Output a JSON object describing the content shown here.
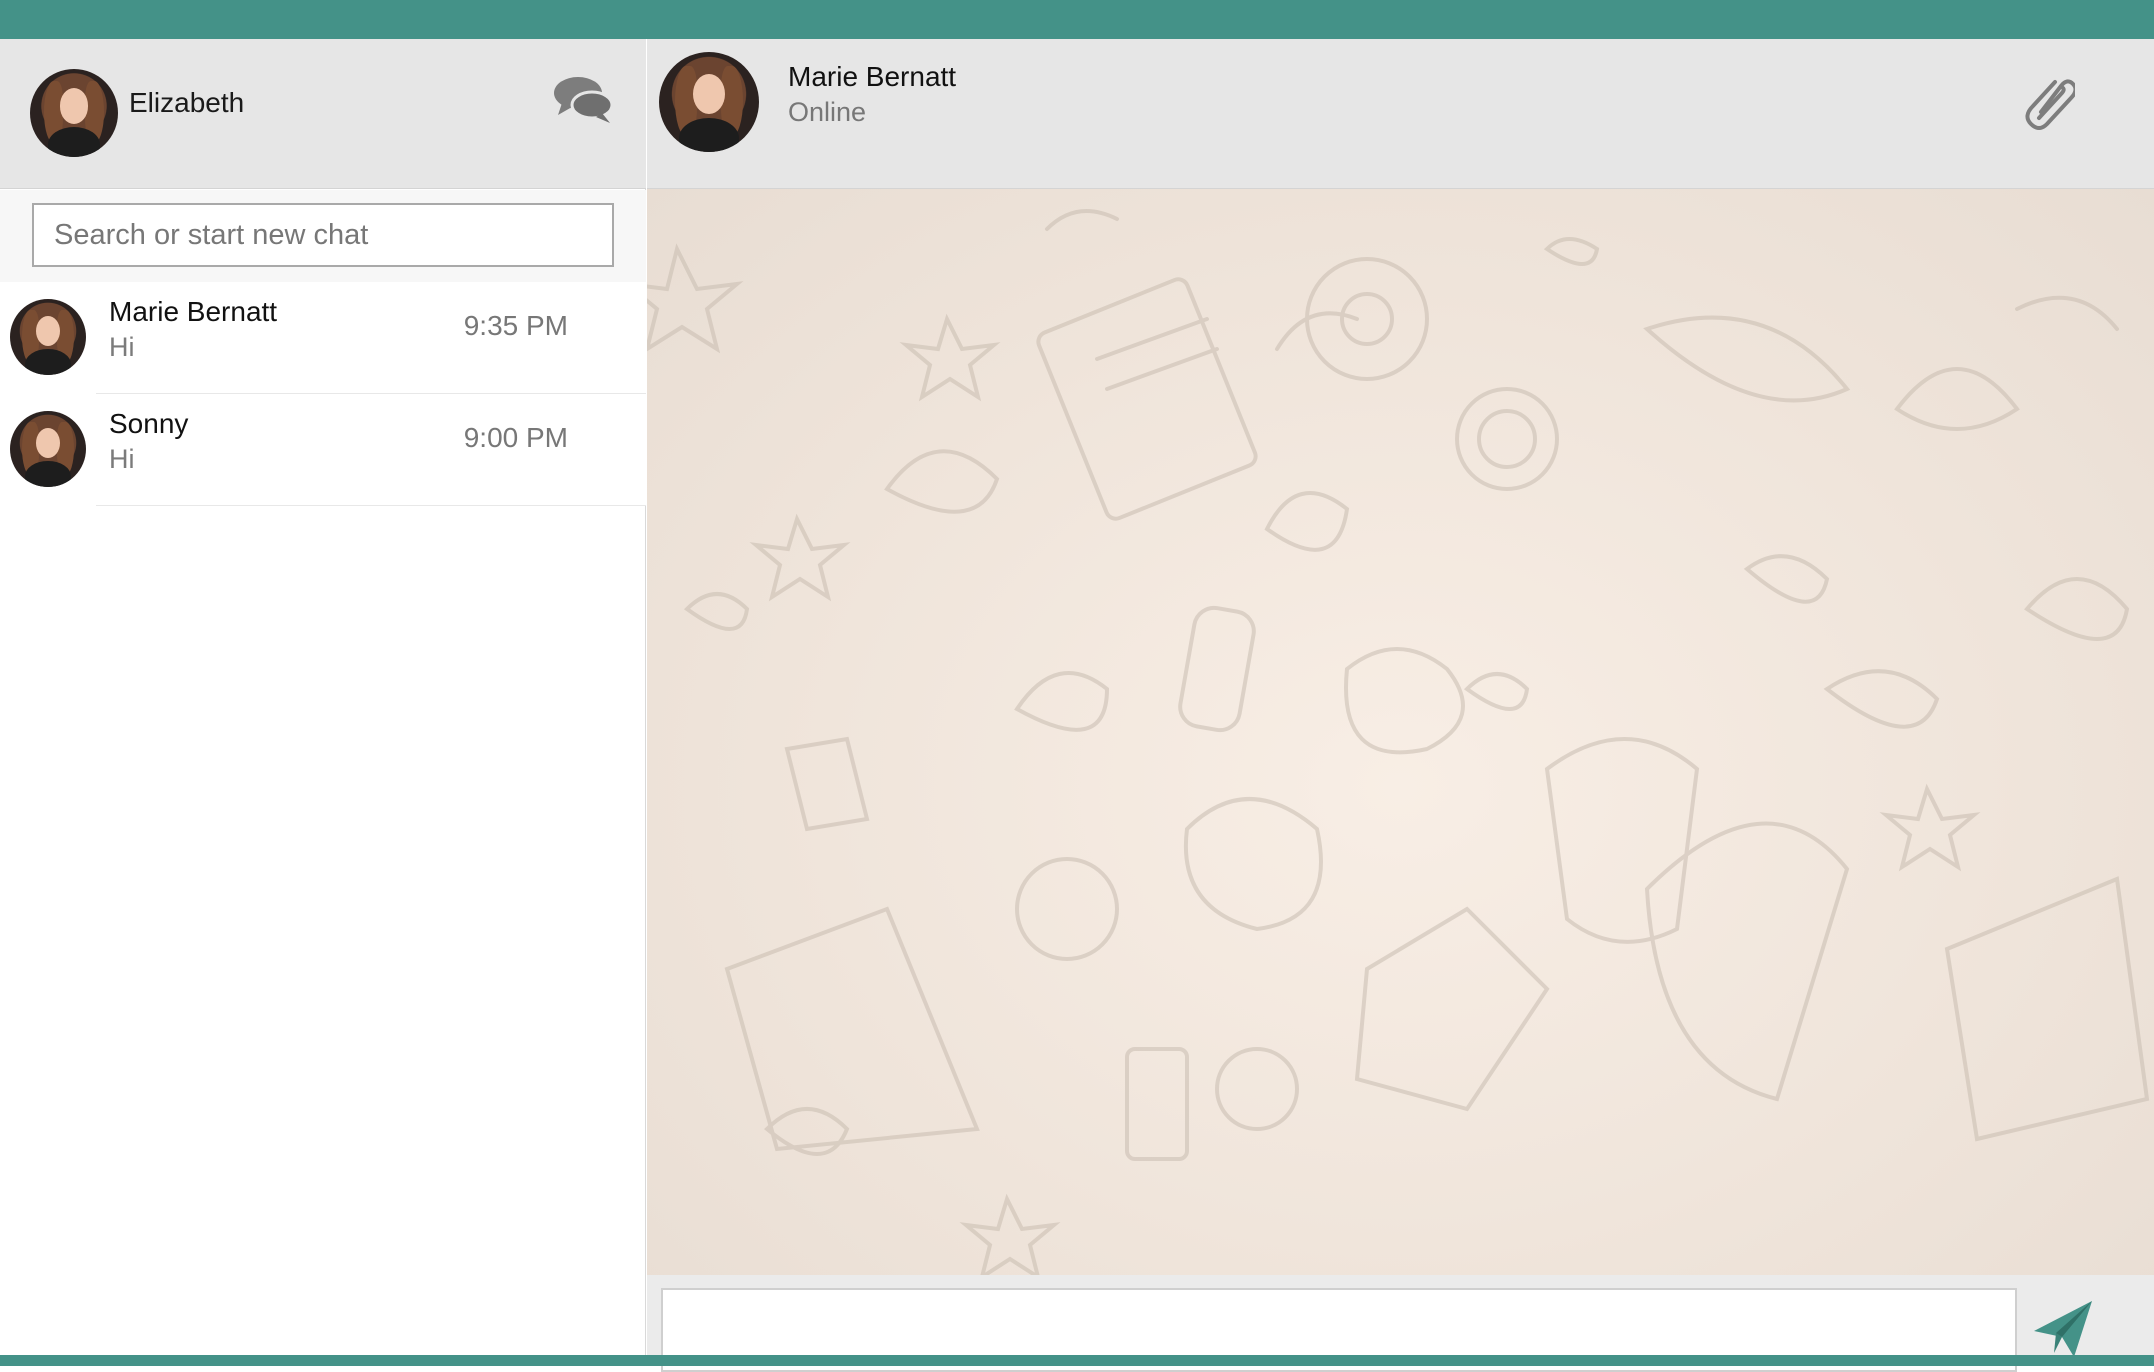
{
  "current_user": {
    "name": "Elizabeth",
    "avatar": "user-avatar"
  },
  "search": {
    "placeholder": "Search or start new chat",
    "value": ""
  },
  "chats": [
    {
      "name": "Marie Bernatt",
      "preview": "Hi",
      "time": "9:35 PM"
    },
    {
      "name": "Sonny",
      "preview": "Hi",
      "time": "9:00 PM"
    }
  ],
  "conversation": {
    "contact_name": "Marie Bernatt",
    "status": "Online",
    "input_value": ""
  },
  "icons": {
    "new_chat": "speech-bubbles-icon",
    "attach": "paperclip-icon",
    "send": "paper-plane-icon"
  },
  "colors": {
    "accent": "#449288",
    "header_bg": "#e6e6e6",
    "chat_bg": "#f3e9df"
  }
}
